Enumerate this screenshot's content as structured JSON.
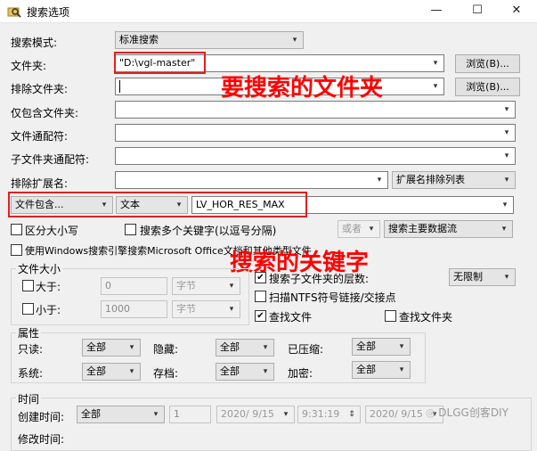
{
  "window": {
    "title": "搜索选项",
    "minimize": "—",
    "maximize": "☐",
    "close": "✕"
  },
  "rows": {
    "search_mode": {
      "label": "搜索模式:",
      "value": "标准搜索"
    },
    "folder": {
      "label": "文件夹:",
      "value": "\"D:\\vgl-master\"",
      "browse": "浏览(B)..."
    },
    "exclude_folder": {
      "label": "排除文件夹:",
      "value": "",
      "browse": "浏览(B)..."
    },
    "only_folder": {
      "label": "仅包含文件夹:",
      "value": ""
    },
    "file_wildcard": {
      "label": "文件通配符:",
      "value": ""
    },
    "subfolder_wildcard": {
      "label": "子文件夹通配符:",
      "value": ""
    },
    "exclude_ext": {
      "label": "排除扩展名:",
      "value": "",
      "list": "扩展名排除列表"
    }
  },
  "content_search": {
    "mode": "文件包含...",
    "type": "文本",
    "value": "LV_HOR_RES_MAX"
  },
  "options": {
    "case": "区分大小写",
    "multi_keyword": "搜索多个关键字(以逗号分隔)",
    "or": "或者",
    "main_stream": "搜索主要数据流",
    "windows_search": "使用Windows搜索引擎搜索Microsoft Office文档和其他类型文件"
  },
  "annotations": {
    "folder_note": "要搜索的文件夹",
    "keyword_note": "搜索的关键字"
  },
  "file_size": {
    "legend": "文件大小",
    "greater": {
      "label": "大于:",
      "value": "0",
      "unit": "字节"
    },
    "less": {
      "label": "小于:",
      "value": "1000",
      "unit": "字节"
    }
  },
  "search_sub": {
    "depth_label": "搜索子文件夹的层数:",
    "depth_value": "无限制",
    "ntfs": "扫描NTFS符号链接/交接点",
    "find_files": "查找文件",
    "find_folders": "查找文件夹"
  },
  "attributes": {
    "legend": "属性",
    "readonly": {
      "label": "只读:",
      "value": "全部"
    },
    "hidden": {
      "label": "隐藏:",
      "value": "全部"
    },
    "compressed": {
      "label": "已压缩:",
      "value": "全部"
    },
    "system": {
      "label": "系统:",
      "value": "全部"
    },
    "archive": {
      "label": "存档:",
      "value": "全部"
    },
    "encrypted": {
      "label": "加密:",
      "value": "全部"
    }
  },
  "time": {
    "legend": "时间",
    "created": {
      "label": "创建时间:",
      "mode": "全部",
      "num": "1",
      "date1": "2020/ 9/15",
      "time1": "9:31:19",
      "date2": "2020/ 9/15"
    },
    "modified": {
      "label": "修改时间:"
    }
  },
  "watermark": "DLGG创客DIY"
}
